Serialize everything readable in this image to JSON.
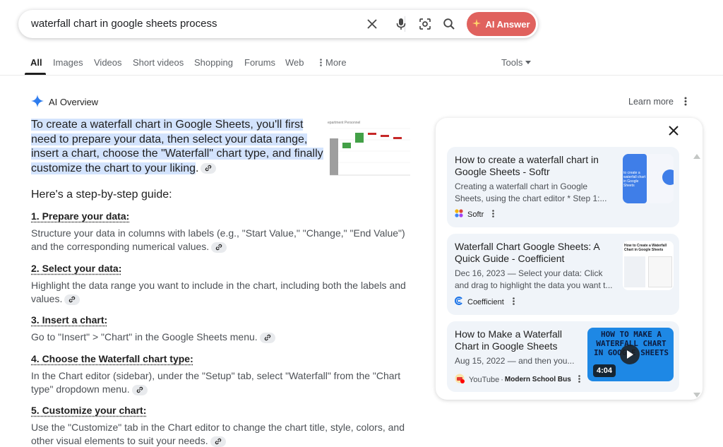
{
  "search": {
    "query": "waterfall chart in google sheets process",
    "ai_answer_label": "AI Answer"
  },
  "tabs": [
    {
      "label": "All"
    },
    {
      "label": "Images"
    },
    {
      "label": "Videos"
    },
    {
      "label": "Short videos"
    },
    {
      "label": "Shopping"
    },
    {
      "label": "Forums"
    },
    {
      "label": "Web"
    },
    {
      "label": "More"
    }
  ],
  "tools_label": "Tools",
  "overview": {
    "header": "AI Overview",
    "learn_more": "Learn more",
    "summary_part1": "To create a waterfall chart in Google Sheets, you'll first need to prepare your data, then select your data range, insert a chart, choose the \"Waterfall\" chart type, and finally customize the chart to your liking",
    "summary_end": ".",
    "thumb_title": "epartment Personnel",
    "guide_title": "Here's a step-by-step guide:",
    "steps": [
      {
        "title": "1. Prepare your data:",
        "text": "Structure your data in columns with labels (e.g., \"Start Value,\" \"Change,\" \"End Value\") and the corresponding numerical values."
      },
      {
        "title": "2. Select your data:",
        "text": "Highlight the data range you want to include in the chart, including both the labels and values."
      },
      {
        "title": "3. Insert a chart:",
        "text": "Go to \"Insert\" > \"Chart\" in the Google Sheets menu."
      },
      {
        "title": "4. Choose the Waterfall chart type:",
        "text": "In the Chart editor (sidebar), under the \"Setup\" tab, select \"Waterfall\" from the \"Chart type\" dropdown menu."
      },
      {
        "title": "5. Customize your chart:",
        "text": "Use the \"Customize\" tab in the Chart editor to change the chart title, style, colors, and other visual elements to suit your needs."
      }
    ]
  },
  "sources": [
    {
      "title": "How to create a waterfall chart in Google Sheets - Softr",
      "snippet": "Creating a waterfall chart in Google Sheets, using the chart editor * Step 1:...",
      "source": "Softr",
      "thumb_text": "to create a waterfall chart in Google Sheets"
    },
    {
      "title": "Waterfall Chart Google Sheets: A Quick Guide - Coefficient",
      "snippet": "Dec 16, 2023 — Select your data: Click and drag to highlight the data you want t...",
      "source": "Coefficient",
      "thumb_text": "How to Create a Waterfall Chart in Google Sheets"
    },
    {
      "title": "How to Make a Waterfall Chart in Google Sheets",
      "snippet": "Aug 15, 2022 — and then you...",
      "source": "YouTube",
      "channel": "Modern School Bus",
      "thumb_text": "HOW TO MAKE A WATERFALL CHART IN GOOGLE SHEETS",
      "duration": "4:04"
    }
  ],
  "colors": {
    "accent_blue": "#1a73e8",
    "ai_button": "#e0625e",
    "highlight": "#d3e3fd",
    "card_bg": "#f0f4f9"
  }
}
